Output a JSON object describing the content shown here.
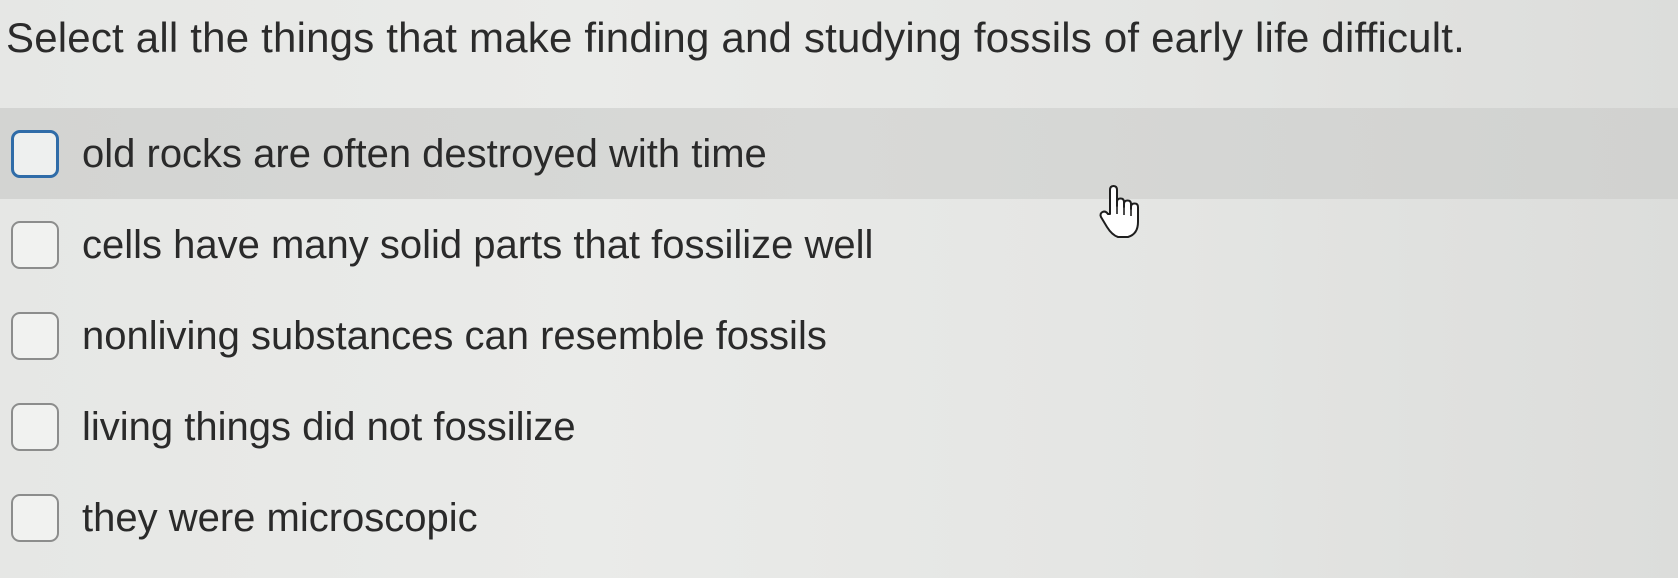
{
  "question": {
    "text": "Select all the things that make finding and studying fossils of early life difficult."
  },
  "options": [
    {
      "label": "old rocks are often destroyed with time",
      "checked": false,
      "hovered": true
    },
    {
      "label": "cells have many solid parts that fossilize well",
      "checked": false,
      "hovered": false
    },
    {
      "label": "nonliving substances can resemble fossils",
      "checked": false,
      "hovered": false
    },
    {
      "label": "living things did not fossilize",
      "checked": false,
      "hovered": false
    },
    {
      "label": "they were microscopic",
      "checked": false,
      "hovered": false
    }
  ],
  "cursor": {
    "icon": "hand-pointer-icon"
  },
  "colors": {
    "hover_row": "#d6d7d5",
    "checkbox_focus_border": "#2f6ca8",
    "checkbox_border": "#8c8d8c",
    "text": "#2a2a2a"
  }
}
